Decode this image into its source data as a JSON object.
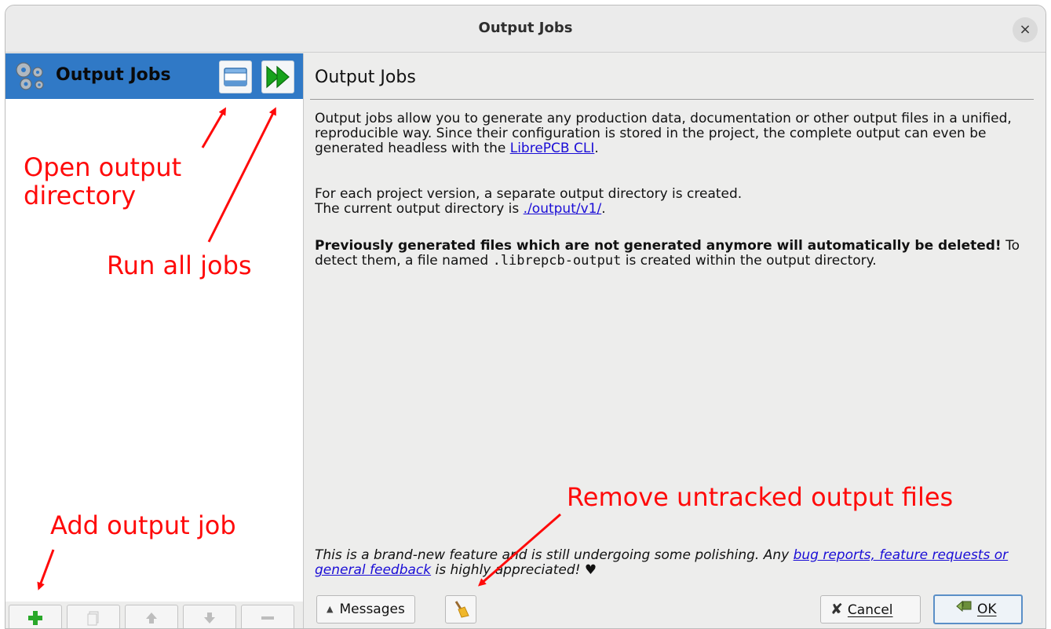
{
  "window": {
    "title": "Output Jobs",
    "close_glyph": "×"
  },
  "sidebar": {
    "header_label": "Output Jobs",
    "header_icon": "gears-icon",
    "header_buttons": [
      {
        "name": "open-output-directory-button",
        "icon": "folder-icon"
      },
      {
        "name": "run-all-jobs-button",
        "icon": "fast-forward-icon"
      }
    ],
    "toolbar": [
      {
        "name": "add-job-button",
        "icon": "plus-icon",
        "enabled": true
      },
      {
        "name": "copy-job-button",
        "icon": "copy-icon",
        "enabled": false
      },
      {
        "name": "move-up-button",
        "icon": "arrow-up-icon",
        "enabled": false
      },
      {
        "name": "move-down-button",
        "icon": "arrow-down-icon",
        "enabled": false
      },
      {
        "name": "remove-job-button",
        "icon": "minus-icon",
        "enabled": false
      }
    ]
  },
  "main": {
    "title": "Output Jobs",
    "intro_text": "Output jobs allow you to generate any production data, documentation or other output files in a unified, reproducible way. Since their configuration is stored in the project, the complete output can even be generated headless with the ",
    "cli_link": "LibrePCB CLI",
    "intro_end": ".",
    "version_line1": "For each project version, a separate output directory is created.",
    "version_line2_prefix": "The current output directory is ",
    "output_dir_link": "./output/v1/",
    "version_line2_end": ".",
    "warning_bold": "Previously generated files which are not generated anymore will automatically be deleted!",
    "warning_rest_1": " To detect them, a file named ",
    "warning_file": ".librepcb-output",
    "warning_rest_2": " is created within the output directory.",
    "feedback_prefix": "This is a brand-new feature and is still undergoing some polishing. Any ",
    "feedback_link": "bug reports, feature requests or general feedback",
    "feedback_suffix": " is highly appreciated! ♥"
  },
  "footer": {
    "messages_label": "Messages",
    "messages_arrow": "▲",
    "cleanup_icon": "broom-icon",
    "cancel_label": "Cancel",
    "ok_label": "OK"
  },
  "annotations": {
    "open_output_dir": "Open output\ndirectory",
    "run_all": "Run all jobs",
    "add_job": "Add output job",
    "remove_untracked": "Remove untracked output files"
  },
  "colors": {
    "accent": "#3079c6",
    "annotation": "#ff0a0a",
    "link": "#1a0dd6",
    "run_green": "#17a31c"
  }
}
